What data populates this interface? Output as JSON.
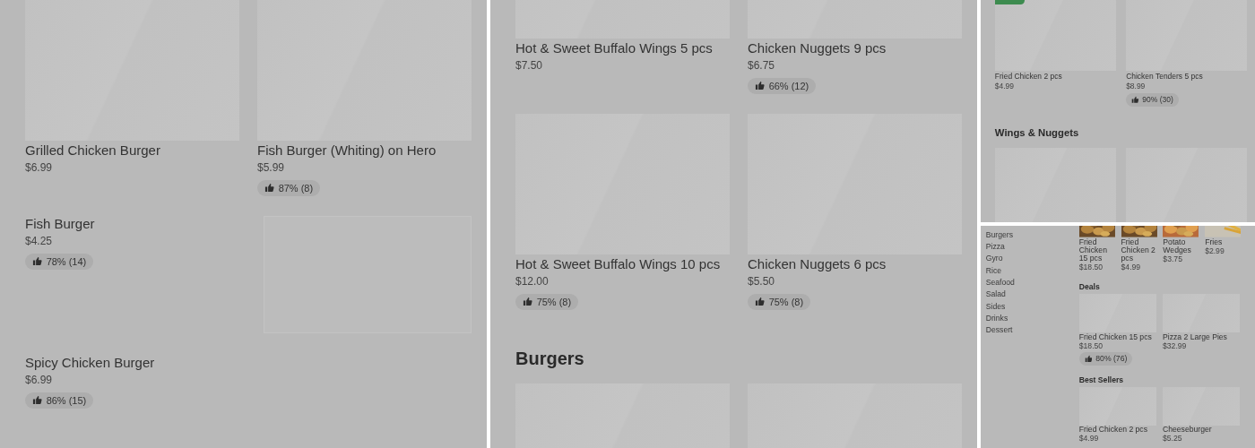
{
  "panels": [
    {
      "kind": "full",
      "sections": [
        {
          "items": [
            {
              "kind": "tile",
              "name": "Grilled Chicken Burger",
              "price": "$6.99"
            },
            {
              "kind": "tile",
              "name": "Fish Burger (Whiting) on Hero",
              "price": "$5.99",
              "rating": "87% (8)"
            },
            {
              "kind": "row",
              "name": "Fish Burger",
              "price": "$4.25",
              "rating": "78% (14)"
            },
            {
              "kind": "text",
              "name": "Spicy Chicken Burger",
              "price": "$6.99",
              "rating": "86% (15)"
            }
          ]
        }
      ]
    },
    {
      "kind": "full",
      "sections": [
        {
          "items": [
            {
              "kind": "tile",
              "name": "Hot & Sweet Buffalo Wings 5 pcs",
              "price": "$7.50"
            },
            {
              "kind": "tile",
              "name": "Chicken Nuggets 9 pcs",
              "price": "$6.75",
              "rating": "66% (12)"
            },
            {
              "kind": "tile",
              "name": "Hot & Sweet Buffalo Wings 10 pcs",
              "price": "$12.00",
              "rating": "75% (8)"
            },
            {
              "kind": "tile",
              "name": "Chicken Nuggets 6 pcs",
              "price": "$5.50",
              "rating": "75% (8)"
            }
          ]
        },
        {
          "heading": "Burgers",
          "items": [
            {
              "kind": "tile"
            },
            {
              "kind": "tile"
            }
          ]
        }
      ]
    },
    {
      "kind": "compact",
      "sections": [
        {
          "items": [
            {
              "kind": "tile",
              "tagged": true,
              "name": "Fried Chicken 2 pcs",
              "price": "$4.99"
            },
            {
              "kind": "tile",
              "tagged": false,
              "name": "Chicken Tenders 5  pcs",
              "price": "$8.99",
              "rating": "90% (30)"
            }
          ]
        },
        {
          "heading": "Wings & Nuggets",
          "items": [
            {
              "kind": "tile"
            },
            {
              "kind": "tile"
            }
          ]
        }
      ]
    },
    {
      "kind": "sidebar",
      "categories": [
        "Burgers",
        "Pizza",
        "Gyro",
        "Rice",
        "Seafood",
        "Salad",
        "Sides",
        "Drinks",
        "Dessert"
      ],
      "sections": [
        {
          "items": [
            {
              "name": "Fried Chicken 15 pcs",
              "price": "$18.50"
            },
            {
              "name": "Fried Chicken 2 pcs",
              "price": "$4.99"
            },
            {
              "name": "Potato Wedges",
              "price": "$3.75"
            },
            {
              "name": "Fries",
              "price": "$2.99"
            }
          ]
        },
        {
          "heading": "Deals",
          "items": [
            {
              "kind": "tile",
              "name": "Fried Chicken 15 pcs",
              "price": "$18.50",
              "rating": "80% (76)"
            },
            {
              "kind": "tile",
              "name": "Pizza 2 Large Pies",
              "price": "$32.99"
            }
          ]
        },
        {
          "heading": "Best Sellers",
          "items": [
            {
              "kind": "tile",
              "name": "Fried Chicken 2 pcs",
              "price": "$4.99"
            },
            {
              "kind": "tile",
              "name": "Cheeseburger",
              "price": "$5.25"
            }
          ]
        }
      ]
    }
  ]
}
